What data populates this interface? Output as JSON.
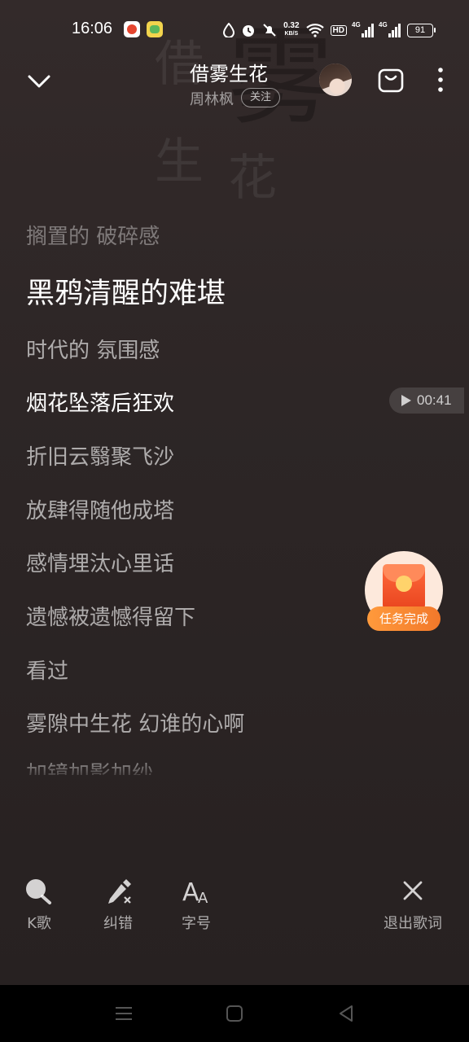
{
  "status_bar": {
    "time": "16:06",
    "net_speed_value": "0.32",
    "net_speed_unit": "KB/S",
    "hd_label": "HD",
    "signal1_label": "4G",
    "signal2_label": "4G",
    "battery": "91"
  },
  "header": {
    "song_title": "借雾生花",
    "artist": "周林枫",
    "follow_label": "关注"
  },
  "lyrics": [
    "搁置的 破碎感",
    "黑鸦清醒的难堪",
    "时代的 氛围感",
    "烟花坠落后狂欢",
    "折旧云翳聚飞沙",
    "放肆得随他成塔",
    "感情埋汰心里话",
    "遗憾被遗憾得留下",
    "看过",
    "雾隙中生花 幻谁的心啊",
    "加镜加影加纱"
  ],
  "seek_time": "00:41",
  "task_badge": "任务完成",
  "toolbar": {
    "karaoke": "K歌",
    "correct": "纠错",
    "font_size": "字号",
    "exit_lyrics": "退出歌词"
  },
  "icons": [
    "chevron-down-icon",
    "cart-icon",
    "more-icon",
    "search-mic-icon",
    "pen-icon",
    "font-size-icon",
    "close-icon",
    "play-icon",
    "menu-icon",
    "home-icon",
    "back-icon"
  ],
  "colors": {
    "background": "#2a2323",
    "accent_orange": "#f2782a"
  }
}
